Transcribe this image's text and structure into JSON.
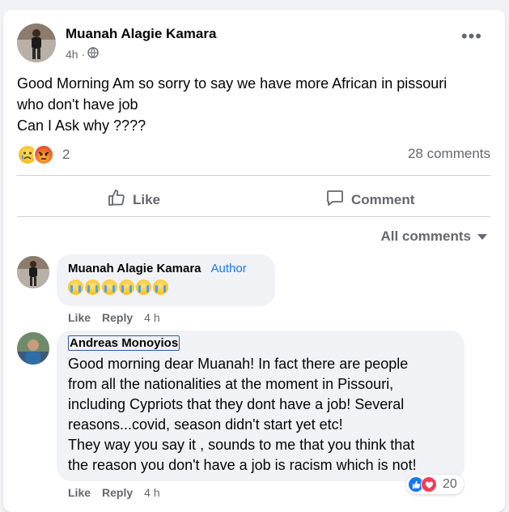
{
  "post": {
    "author": "Muanah Alagie Kamara",
    "time": "4h ·",
    "audience_icon": "globe-icon",
    "text_lines": [
      "Good Morning Am so sorry to say we have more African in pissouri",
      "who don't have job",
      "Can I Ask why ????"
    ],
    "reaction_icons": [
      "sad-emoji-icon",
      "angry-emoji-icon"
    ],
    "reaction_count": "2",
    "comments_count": "28 comments"
  },
  "actions": {
    "like_label": "Like",
    "comment_label": "Comment"
  },
  "comments_filter": "All comments",
  "comments": [
    {
      "author": "Muanah Alagie Kamara",
      "badge": "Author",
      "reaction_emojis": [
        "laughing-tears-icon",
        "laughing-tears-icon",
        "laughing-tears-icon",
        "laughing-tears-icon",
        "laughing-tears-icon",
        "laughing-tears-icon"
      ],
      "like_label": "Like",
      "reply_label": "Reply",
      "time": "4 h"
    },
    {
      "author": "Andreas Monoyios",
      "text_lines": [
        "Good morning dear Muanah! In fact there are people",
        "from all the nationalities at the moment in Pissouri,",
        "including Cypriots that they dont have a job! Several",
        "reasons...covid, season didn't start yet etc!",
        "They way you say it , sounds to me that you think that",
        "the reason you don't have a job is racism which is not!"
      ],
      "reaction_count": "20",
      "like_label": "Like",
      "reply_label": "Reply",
      "time": "4 h"
    }
  ],
  "colors": {
    "accent": "#1877f2",
    "secondary_text": "#65676b",
    "bubble": "#f0f2f5"
  }
}
